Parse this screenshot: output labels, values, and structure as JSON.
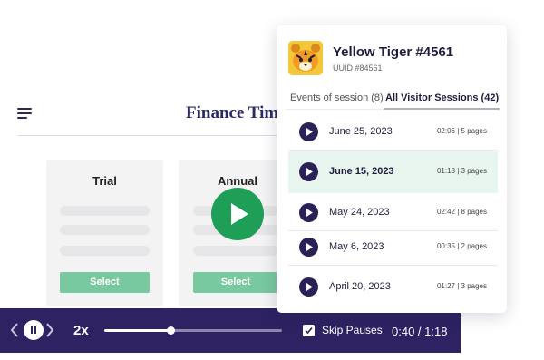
{
  "background_page": {
    "title": "Finance Tim",
    "plans": [
      {
        "name": "Trial",
        "button_label": "Select"
      },
      {
        "name": "Annual",
        "button_label": "Select"
      }
    ]
  },
  "player": {
    "speed": "2x",
    "progress_fraction": 0.375,
    "skip_pauses_label": "Skip Pauses",
    "skip_pauses_checked": true,
    "time": "0:40 / 1:18"
  },
  "visitor": {
    "name": "Yellow Tiger #4561",
    "uuid": "UUID #84561",
    "avatar_icon": "tiger-icon"
  },
  "tabs": [
    {
      "label": "Events of session (8)",
      "active": false
    },
    {
      "label": "All Visitor Sessions (42)",
      "active": true
    }
  ],
  "sessions": [
    {
      "date": "June 25, 2023",
      "duration": "02:06",
      "pages": "5 pages",
      "active": false
    },
    {
      "date": "June 15, 2023",
      "duration": "01:18",
      "pages": "3 pages",
      "active": true
    },
    {
      "date": "May 24, 2023",
      "duration": "02:42",
      "pages": "8 pages",
      "active": false
    },
    {
      "date": "May 6, 2023",
      "duration": "00:35",
      "pages": "2 pages",
      "active": false
    },
    {
      "date": "April 20, 2023",
      "duration": "01:27",
      "pages": "3 pages",
      "active": false
    }
  ],
  "colors": {
    "player_bg": "#2e2262",
    "play_green": "#1f9e57",
    "select_green": "#78c99f",
    "active_row": "#e7f5ee"
  }
}
